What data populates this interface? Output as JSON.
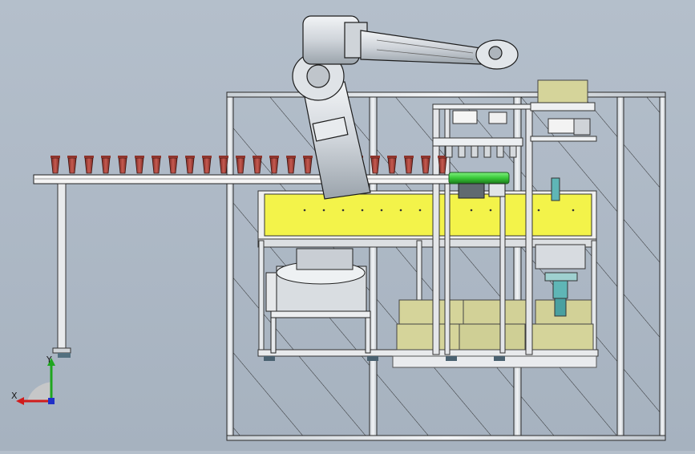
{
  "viewport": {
    "scene": "cad-model-view",
    "colors": {
      "background_top": "#b4bfcb",
      "background_bottom": "#a6b2bf",
      "frame": "#eef1f4",
      "frame_edge": "#2a2a2a",
      "glass_hatch": "#1f1f1f",
      "conveyor": "#f4f4f4",
      "cup": "#b0443c",
      "hopper": "#f3f34a",
      "box": "#d5d49a",
      "gripper": "#3fcf3f",
      "robot": "#d9dde3",
      "cylinder": "#5fb6b6"
    }
  },
  "triad": {
    "y_label": "Y",
    "x_label": "X",
    "colors": {
      "y": "#1fa61f",
      "x": "#d11c1c",
      "z": "#2030c8"
    }
  }
}
